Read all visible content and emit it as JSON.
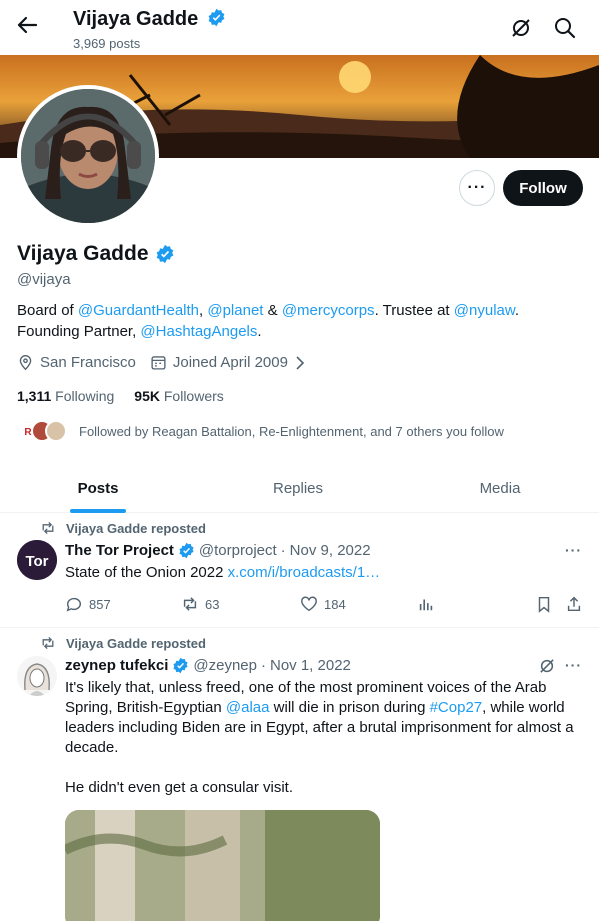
{
  "header": {
    "name": "Vijaya Gadde",
    "posts_count": "3,969 posts"
  },
  "profile": {
    "name": "Vijaya Gadde",
    "handle": "@vijaya",
    "bio": {
      "t1": "Board of ",
      "l1": "@GuardantHealth",
      "t2": ", ",
      "l2": "@planet",
      "t3": " & ",
      "l3": "@mercycorps",
      "t4": ". Trustee at ",
      "l4": "@nyulaw",
      "t5": ".",
      "t6": "Founding Partner, ",
      "l5": "@HashtagAngels",
      "t7": "."
    },
    "location": "San Francisco",
    "joined": "Joined April 2009",
    "following_count": "1,311",
    "following_label": "Following",
    "followers_count": "95K",
    "followers_label": "Followers",
    "followed_by": "Followed by Reagan Battalion, Re-Enlightenment, and 7 others you follow",
    "follow_label": "Follow",
    "more_label": "···"
  },
  "tabs": [
    {
      "label": "Posts"
    },
    {
      "label": "Replies"
    },
    {
      "label": "Media"
    }
  ],
  "posts": [
    {
      "reposted_by": "Vijaya Gadde reposted",
      "author": "The Tor Project",
      "handle": "@torproject",
      "sep": "·",
      "date": "Nov 9, 2022",
      "text": "State of the Onion 2022 ",
      "link": "x.com/i/broadcasts/1…",
      "replies": "857",
      "reposts": "63",
      "likes": "184",
      "avatar_label": "Tor"
    },
    {
      "reposted_by": "Vijaya Gadde reposted",
      "author": "zeynep tufekci",
      "handle": "@zeynep",
      "sep": "·",
      "date": "Nov 1, 2022",
      "t1": "It's likely that, unless freed, one of the most prominent voices of the Arab Spring, British-Egyptian ",
      "l1": "@alaa",
      "t2": " will die in prison during ",
      "l2": "#Cop27",
      "t3": ", while world leaders including Biden are in Egypt, after a brutal imprisonment for almost a decade.",
      "t4": "He didn't even get a consular visit."
    }
  ],
  "colors": {
    "accent": "#1d9bf0",
    "text": "#0f1419",
    "muted": "#536471"
  }
}
